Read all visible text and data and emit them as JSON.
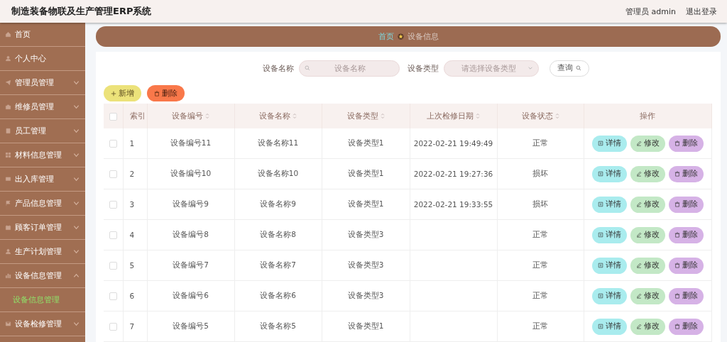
{
  "header": {
    "title": "制造装备物联及生产管理ERP系统",
    "user": "管理员 admin",
    "logout": "退出登录"
  },
  "sidebar": {
    "items": [
      {
        "label": "首页",
        "has_submenu": false
      },
      {
        "label": "个人中心",
        "has_submenu": false
      },
      {
        "label": "管理员管理",
        "has_submenu": true,
        "expanded": false
      },
      {
        "label": "维修员管理",
        "has_submenu": true,
        "expanded": false
      },
      {
        "label": "员工管理",
        "has_submenu": true,
        "expanded": false
      },
      {
        "label": "材料信息管理",
        "has_submenu": true,
        "expanded": false
      },
      {
        "label": "出入库管理",
        "has_submenu": true,
        "expanded": false
      },
      {
        "label": "产品信息管理",
        "has_submenu": true,
        "expanded": false
      },
      {
        "label": "顾客订单管理",
        "has_submenu": true,
        "expanded": false
      },
      {
        "label": "生产计划管理",
        "has_submenu": true,
        "expanded": false
      },
      {
        "label": "设备信息管理",
        "has_submenu": true,
        "expanded": true,
        "children": [
          {
            "label": "设备信息管理",
            "selected": true
          }
        ]
      },
      {
        "label": "设备检修管理",
        "has_submenu": true,
        "expanded": false
      }
    ]
  },
  "breadcrumb": [
    {
      "label": "首页",
      "selected": false
    },
    {
      "label": "设备信息",
      "selected": true
    }
  ],
  "search": {
    "fields": [
      {
        "label": "设备名称",
        "kind": "input",
        "placeholder": "设备名称"
      },
      {
        "label": "设备类型",
        "kind": "select",
        "placeholder": "请选择设备类型"
      }
    ],
    "button": "查询"
  },
  "toolbar": [
    {
      "label": "新增",
      "kind": "add"
    },
    {
      "label": "删除",
      "kind": "delete"
    }
  ],
  "table": {
    "select_all": {
      "checked": false
    },
    "columns": [
      {
        "label": "索引",
        "sortable": false
      },
      {
        "label": "设备编号",
        "sortable": true
      },
      {
        "label": "设备名称",
        "sortable": true
      },
      {
        "label": "设备类型",
        "sortable": true
      },
      {
        "label": "上次检修日期",
        "sortable": true
      },
      {
        "label": "设备状态",
        "sortable": true
      },
      {
        "label": "操作",
        "sortable": false
      }
    ],
    "rows": [
      {
        "checked": false,
        "index": "1",
        "code": "设备编号11",
        "name": "设备名称11",
        "type": "设备类型1",
        "date": "2022-02-21 19:49:49",
        "status": "正常",
        "actions": [
          {
            "label": "详情",
            "kind": "detail"
          },
          {
            "label": "修改",
            "kind": "edit"
          },
          {
            "label": "删除",
            "kind": "delete"
          }
        ]
      },
      {
        "checked": false,
        "index": "2",
        "code": "设备编号10",
        "name": "设备名称10",
        "type": "设备类型1",
        "date": "2022-02-21 19:27:36",
        "status": "损坏",
        "actions": [
          {
            "label": "详情",
            "kind": "detail"
          },
          {
            "label": "修改",
            "kind": "edit"
          },
          {
            "label": "删除",
            "kind": "delete"
          }
        ]
      },
      {
        "checked": false,
        "index": "3",
        "code": "设备编号9",
        "name": "设备名称9",
        "type": "设备类型1",
        "date": "2022-02-21 19:33:55",
        "status": "损坏",
        "actions": [
          {
            "label": "详情",
            "kind": "detail"
          },
          {
            "label": "修改",
            "kind": "edit"
          },
          {
            "label": "删除",
            "kind": "delete"
          }
        ]
      },
      {
        "checked": false,
        "index": "4",
        "code": "设备编号8",
        "name": "设备名称8",
        "type": "设备类型3",
        "status": "正常",
        "actions": [
          {
            "label": "详情",
            "kind": "detail"
          },
          {
            "label": "修改",
            "kind": "edit"
          },
          {
            "label": "删除",
            "kind": "delete"
          }
        ]
      },
      {
        "checked": false,
        "index": "5",
        "code": "设备编号7",
        "name": "设备名称7",
        "type": "设备类型3",
        "status": "正常",
        "actions": [
          {
            "label": "详情",
            "kind": "detail"
          },
          {
            "label": "修改",
            "kind": "edit"
          },
          {
            "label": "删除",
            "kind": "delete"
          }
        ]
      },
      {
        "checked": false,
        "index": "6",
        "code": "设备编号6",
        "name": "设备名称6",
        "type": "设备类型3",
        "status": "正常",
        "actions": [
          {
            "label": "详情",
            "kind": "detail"
          },
          {
            "label": "修改",
            "kind": "edit"
          },
          {
            "label": "删除",
            "kind": "delete"
          }
        ]
      },
      {
        "checked": false,
        "index": "7",
        "code": "设备编号5",
        "name": "设备名称5",
        "type": "设备类型1",
        "status": "正常",
        "actions": [
          {
            "label": "详情",
            "kind": "detail"
          },
          {
            "label": "修改",
            "kind": "edit"
          },
          {
            "label": "删除",
            "kind": "delete"
          }
        ]
      }
    ]
  }
}
